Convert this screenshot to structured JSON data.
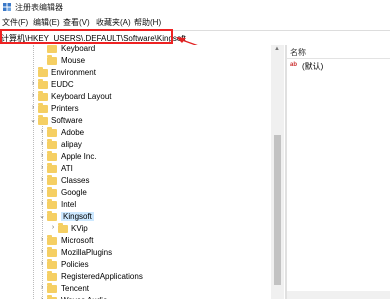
{
  "window": {
    "title": "注册表编辑器"
  },
  "menu": [
    "文件(F)",
    "编辑(E)",
    "查看(V)",
    "收藏夹(A)",
    "帮助(H)"
  ],
  "address": "计算机\\HKEY_USERS\\.DEFAULT\\Software\\Kingsoft",
  "tree": [
    {
      "label": "Keyboard",
      "level": 4,
      "chev": ""
    },
    {
      "label": "Mouse",
      "level": 4,
      "chev": ""
    },
    {
      "label": "Environment",
      "level": 3,
      "chev": ""
    },
    {
      "label": "EUDC",
      "level": 3,
      "chev": ">"
    },
    {
      "label": "Keyboard Layout",
      "level": 3,
      "chev": ">"
    },
    {
      "label": "Printers",
      "level": 3,
      "chev": ">"
    },
    {
      "label": "Software",
      "level": 3,
      "chev": "v"
    },
    {
      "label": "Adobe",
      "level": 4,
      "chev": ">"
    },
    {
      "label": "alipay",
      "level": 4,
      "chev": ">"
    },
    {
      "label": "Apple Inc.",
      "level": 4,
      "chev": ">"
    },
    {
      "label": "ATI",
      "level": 4,
      "chev": ">"
    },
    {
      "label": "Classes",
      "level": 4,
      "chev": ">"
    },
    {
      "label": "Google",
      "level": 4,
      "chev": ">"
    },
    {
      "label": "Intel",
      "level": 4,
      "chev": ">"
    },
    {
      "label": "Kingsoft",
      "level": 4,
      "chev": "v",
      "selected": true
    },
    {
      "label": "KVip",
      "level": 5,
      "chev": ">"
    },
    {
      "label": "Microsoft",
      "level": 4,
      "chev": ">"
    },
    {
      "label": "MozillaPlugins",
      "level": 4,
      "chev": ">"
    },
    {
      "label": "Policies",
      "level": 4,
      "chev": ">"
    },
    {
      "label": "RegisteredApplications",
      "level": 4,
      "chev": ""
    },
    {
      "label": "Tencent",
      "level": 4,
      "chev": ">"
    },
    {
      "label": "Waves Audio",
      "level": 4,
      "chev": ">"
    }
  ],
  "values_pane": {
    "column_header": "名称",
    "values": [
      {
        "icon": "ab",
        "name": "(默认)"
      }
    ]
  },
  "colors": {
    "highlight": "#e22222",
    "folder": "#f5cf63",
    "selection": "#cce8ff"
  }
}
